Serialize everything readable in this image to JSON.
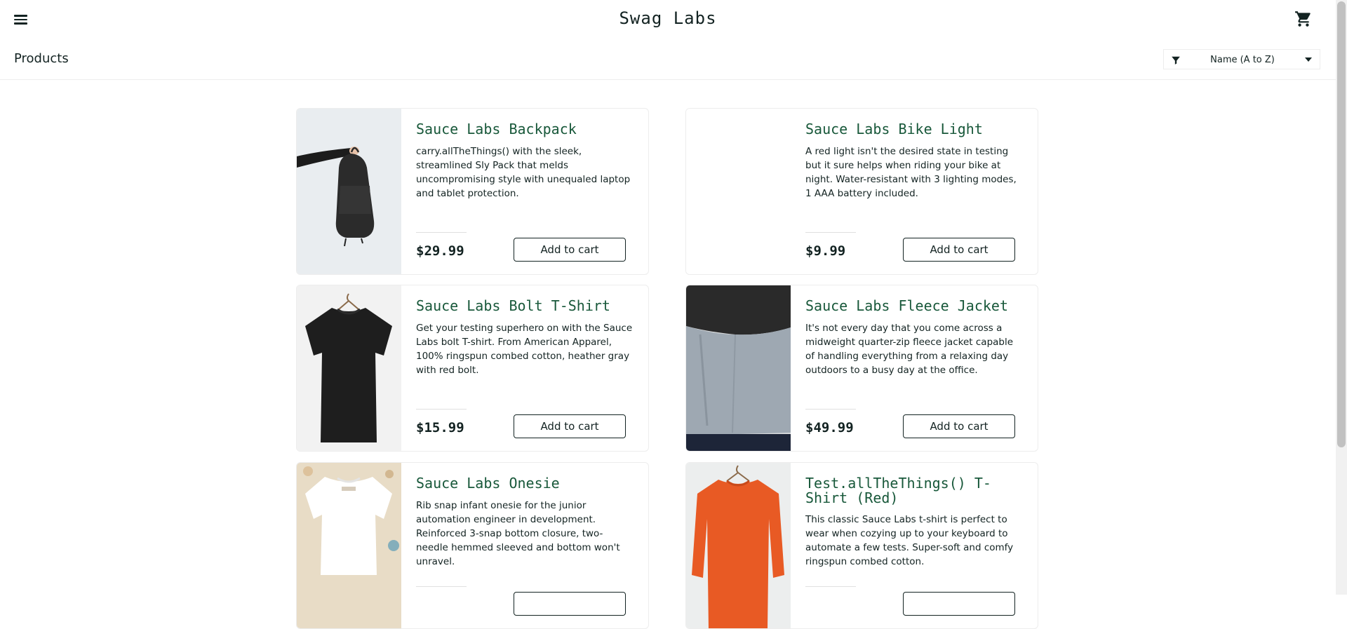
{
  "header": {
    "logo": "Swag Labs",
    "menu_icon": "hamburger-icon",
    "cart_icon": "shopping-cart-icon"
  },
  "subheader": {
    "title": "Products",
    "sort": {
      "selected": "Name (A to Z)",
      "icon": "filter-icon"
    }
  },
  "colors": {
    "accent": "#18583a",
    "text": "#132322",
    "border": "#ededed"
  },
  "products": [
    {
      "name": "Sauce Labs Backpack",
      "description": "carry.allTheThings() with the sleek, streamlined Sly Pack that melds uncompromising style with unequaled laptop and tablet protection.",
      "price": "$29.99",
      "button": "Add to cart"
    },
    {
      "name": "Sauce Labs Bike Light",
      "description": "A red light isn't the desired state in testing but it sure helps when riding your bike at night. Water-resistant with 3 lighting modes, 1 AAA battery included.",
      "price": "$9.99",
      "button": "Add to cart"
    },
    {
      "name": "Sauce Labs Bolt T-Shirt",
      "description": "Get your testing superhero on with the Sauce Labs bolt T-shirt. From American Apparel, 100% ringspun combed cotton, heather gray with red bolt.",
      "price": "$15.99",
      "button": "Add to cart"
    },
    {
      "name": "Sauce Labs Fleece Jacket",
      "description": "It's not every day that you come across a midweight quarter-zip fleece jacket capable of handling everything from a relaxing day outdoors to a busy day at the office.",
      "price": "$49.99",
      "button": "Add to cart"
    },
    {
      "name": "Sauce Labs Onesie",
      "description": "Rib snap infant onesie for the junior automation engineer in development. Reinforced 3-snap bottom closure, two-needle hemmed sleeved and bottom won't unravel.",
      "price": "",
      "button": ""
    },
    {
      "name": "Test.allTheThings() T-Shirt (Red)",
      "description": "This classic Sauce Labs t-shirt is perfect to wear when cozying up to your keyboard to automate a few tests. Super-soft and comfy ringspun combed cotton.",
      "price": "",
      "button": ""
    }
  ]
}
